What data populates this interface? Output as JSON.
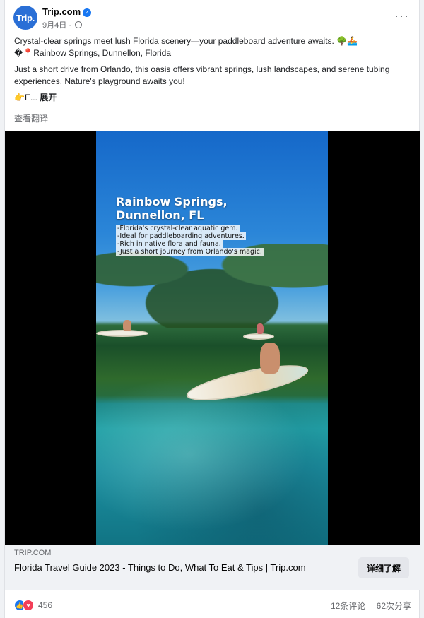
{
  "post": {
    "avatar_text": "Trip.",
    "author": "Trip.com",
    "date": "9月4日 ·",
    "text_line1": "Crystal-clear springs meet lush Florida scenery—your paddleboard adventure awaits. 🌳🚣",
    "text_line2": "�📍Rainbow Springs, Dunnellon, Florida",
    "text_para2": "Just a short drive from Orlando, this oasis offers vibrant springs, lush landscapes, and serene tubing experiences. Nature's playground awaits you!",
    "text_prefix": "👉E... ",
    "see_more": "展开",
    "translate": "查看翻译",
    "more_menu": "···"
  },
  "video": {
    "title_line1": "Rainbow Springs,",
    "title_line2": "Dunnellon, FL",
    "bullets": [
      "-Florida's crystal-clear aquatic gem.",
      "-Ideal for paddleboarding adventures.",
      "-Rich in native flora and fauna.",
      "-Just a short journey from Orlando's magic."
    ]
  },
  "link": {
    "domain": "TRIP.COM",
    "title": "Florida Travel Guide 2023 - Things to Do, What To Eat & Tips | Trip.com",
    "cta": "详细了解"
  },
  "stats": {
    "reaction_count": "456",
    "comments": "12条评论",
    "shares": "62次分享"
  },
  "colors": {
    "brand": "#2a6fd6",
    "like": "#1877f2",
    "love": "#f33e58"
  }
}
